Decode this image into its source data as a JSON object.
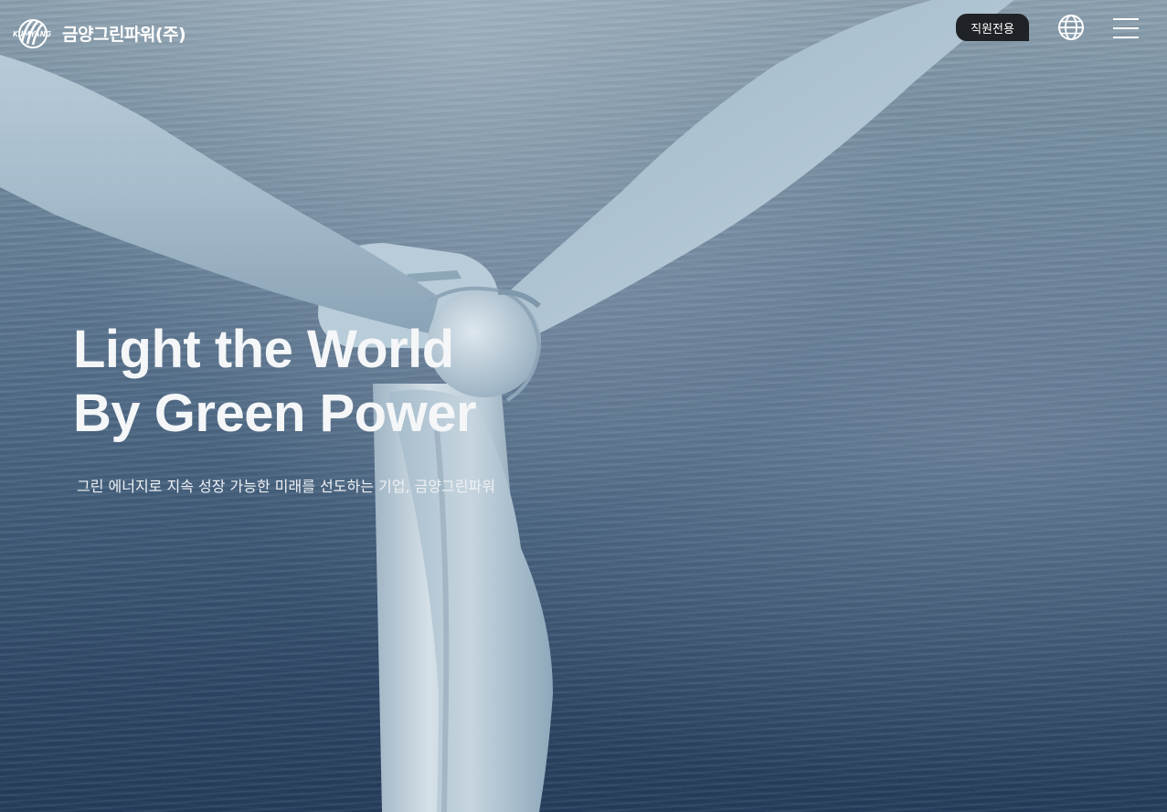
{
  "header": {
    "logo": {
      "brand_mark_text": "KUMYANG",
      "company_name": "금양그린파워(주)"
    },
    "staff_button_label": "직원전용",
    "icons": {
      "language": "globe-icon",
      "menu": "hamburger-menu-icon"
    }
  },
  "hero": {
    "headline_line1": "Light the World",
    "headline_line2": "By Green Power",
    "subtitle": "그린 에너지로 지속 성장 가능한 미래를 선도하는 기업, 금양그린파워"
  },
  "colors": {
    "text": "#ffffff",
    "staff_button_bg": "#1f2226",
    "sea_dark": "#253d5c",
    "sea_light": "#8fa3b2",
    "turbine": "#c9d6df"
  }
}
